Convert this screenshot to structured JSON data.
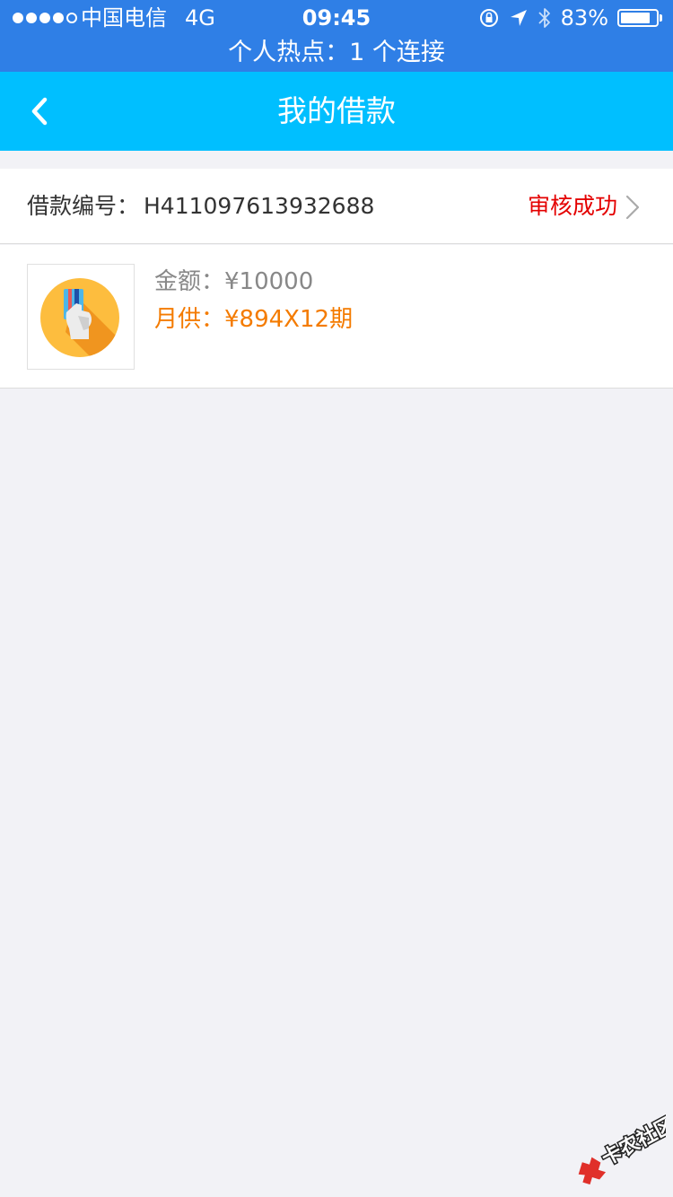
{
  "status_bar": {
    "carrier": "中国电信",
    "network": "4G",
    "time": "09:45",
    "battery": "83%",
    "hotspot": "个人热点：1 个连接"
  },
  "nav": {
    "title": "我的借款"
  },
  "loan": {
    "number_label": "借款编号：",
    "number_value": "H411097613932688",
    "status": "审核成功",
    "amount_label": "金额：",
    "amount_value": "¥10000",
    "monthly_label": "月供：",
    "monthly_value": "¥894X12期"
  },
  "watermark": {
    "text": "卡农社区"
  },
  "colors": {
    "status_bar": "#2f7fe6",
    "nav_bar": "#00bfff",
    "status_success": "#e40000",
    "monthly": "#f47b00",
    "background": "#f2f2f6"
  }
}
